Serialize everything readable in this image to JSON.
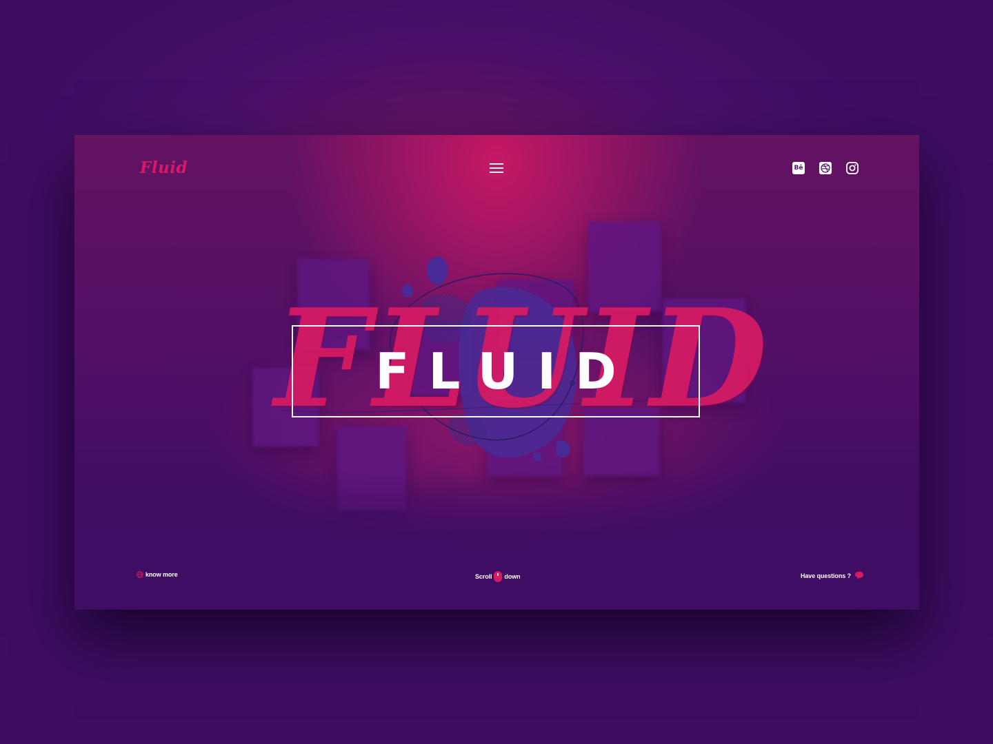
{
  "header": {
    "logo": "Fluid",
    "menu_icon": "hamburger-menu-icon",
    "social": [
      {
        "name": "behance-icon",
        "label": "Bē"
      },
      {
        "name": "dribbble-icon",
        "label": ""
      },
      {
        "name": "instagram-icon",
        "label": ""
      }
    ]
  },
  "hero": {
    "brush_text": "FLUID",
    "title": "FLUID"
  },
  "footer": {
    "know_more": "know more",
    "scroll_before": "Scroll",
    "scroll_after": "down",
    "questions": "Have questions ?"
  },
  "colors": {
    "accent": "#d81a63",
    "background": "#3f0d63",
    "text": "#ffffff"
  }
}
